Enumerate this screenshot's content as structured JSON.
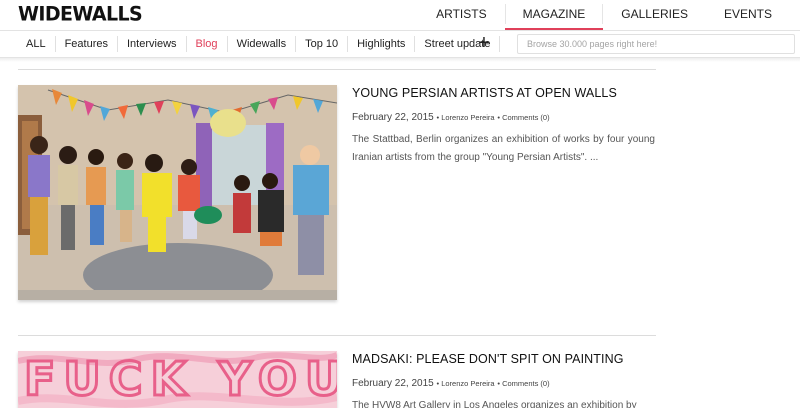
{
  "brand": {
    "logo": "WIDEWALLS"
  },
  "main_nav": [
    {
      "label": "ARTISTS",
      "active": false
    },
    {
      "label": "MAGAZINE",
      "active": true
    },
    {
      "label": "GALLERIES",
      "active": false
    },
    {
      "label": "EVENTS",
      "active": false
    }
  ],
  "sub_nav": {
    "tabs": [
      {
        "label": "ALL",
        "active": false
      },
      {
        "label": "Features",
        "active": false
      },
      {
        "label": "Interviews",
        "active": false
      },
      {
        "label": "Blog",
        "active": true
      },
      {
        "label": "Widewalls",
        "active": false
      },
      {
        "label": "Top 10",
        "active": false
      },
      {
        "label": "Highlights",
        "active": false
      },
      {
        "label": "Street update",
        "active": false
      }
    ],
    "more_glyph": "+",
    "search_placeholder": "Browse 30.000 pages right here!"
  },
  "colors": {
    "accent": "#e0405a",
    "divider": "#dcdcdc"
  },
  "articles": [
    {
      "title": "YOUNG PERSIAN ARTISTS AT OPEN WALLS",
      "date": "February 22, 2015",
      "author": "Lorenzo Pereira",
      "comments": "Comments (0)",
      "excerpt": "The Stattbad, Berlin organizes an exhibition of works by four young Iranian artists from the group \"Young Persian Artists\". ..."
    },
    {
      "title": "MADSAKI: PLEASE DON'T SPIT ON PAINTING",
      "date": "February 22, 2015",
      "author": "Lorenzo Pereira",
      "comments": "Comments (0)",
      "excerpt": "The HVW8 Art Gallery in Los Angeles organizes an exhibition by",
      "image_text": "FUCK YOU"
    }
  ]
}
